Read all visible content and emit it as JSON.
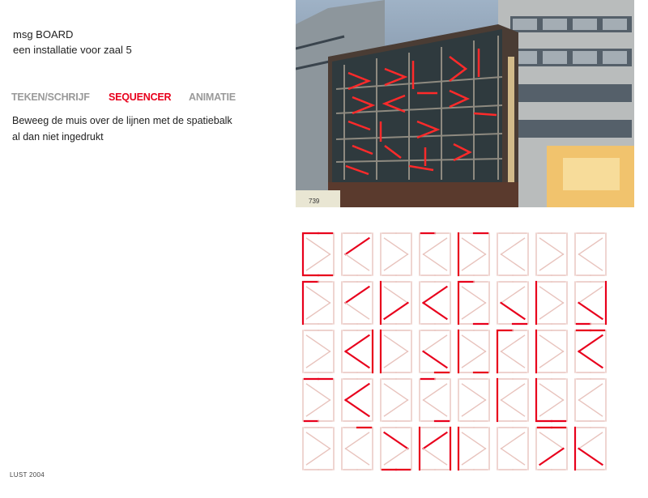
{
  "header": {
    "title": "msg BOARD",
    "subtitle": "een installatie voor zaal 5"
  },
  "nav": {
    "items": [
      {
        "label": "TEKEN/SCHRIJF",
        "active": false
      },
      {
        "label": "SEQUENCER",
        "active": true
      },
      {
        "label": "ANIMATIE",
        "active": false
      }
    ]
  },
  "instructions": {
    "line1": "Beweeg de muis over de lijnen met de spatiebalk",
    "line2": "al dan niet ingedrukt"
  },
  "footer": {
    "credit": "LUST 2004"
  },
  "photo": {
    "bus_number": "739"
  },
  "colors": {
    "accent": "#e8001c",
    "inactive_line": "#e8c3bd",
    "nav_inactive": "#9a9a9a"
  },
  "board": {
    "rows": 5,
    "cols": 8,
    "cells": [
      [
        "kA",
        "k1",
        "k0",
        "kB",
        "kC",
        "k0",
        "k0",
        "k0"
      ],
      [
        "kD",
        "k1",
        "kE",
        "kF",
        "kG",
        "kH",
        "kI",
        "kJ"
      ],
      [
        "k0",
        "kK",
        "kL",
        "kM",
        "kN",
        "kO",
        "kP",
        "kQ"
      ],
      [
        "kR",
        "kS",
        "k0",
        "kT",
        "k0",
        "kU",
        "kV",
        "k0"
      ],
      [
        "k0",
        "kW",
        "kX",
        "kY",
        "kZ",
        "k0",
        "ka",
        "kb"
      ]
    ],
    "patterns": {
      "k0": [],
      "k1": [
        "da1"
      ],
      "kA": [
        "lv",
        "ta",
        "tb",
        "ba",
        "bb"
      ],
      "kB": [
        "ta"
      ],
      "kC": [
        "lv",
        "tb"
      ],
      "kD": [
        "lv",
        "ta"
      ],
      "kE": [
        "lv",
        "da2"
      ],
      "kF": [
        "da1",
        "da2"
      ],
      "kG": [
        "lv",
        "ta",
        "bb"
      ],
      "kH": [
        "da2",
        "bb"
      ],
      "kI": [
        "lv"
      ],
      "kJ": [
        "rv",
        "da2",
        "ba"
      ],
      "kK": [
        "rv",
        "da1",
        "da2"
      ],
      "kL": [
        "lv"
      ],
      "kM": [
        "da2",
        "bb"
      ],
      "kN": [
        "lv",
        "bb"
      ],
      "kO": [
        "ta",
        "lv"
      ],
      "kP": [
        "lv"
      ],
      "kQ": [
        "ta",
        "tb",
        "da1",
        "da2"
      ],
      "kR": [
        "tb",
        "ta",
        "ba"
      ],
      "kS": [
        "da1",
        "da2"
      ],
      "kT": [
        "ta",
        "bb"
      ],
      "kU": [
        "lv"
      ],
      "kV": [
        "lv",
        "ba",
        "bb"
      ],
      "kW": [
        "tb"
      ],
      "kX": [
        "ba",
        "bb",
        "da1"
      ],
      "kY": [
        "da1",
        "lv",
        "rv"
      ],
      "kZ": [
        "lv"
      ],
      "ka": [
        "ta",
        "tb",
        "da2"
      ],
      "kb": [
        "lv",
        "da2"
      ]
    }
  }
}
